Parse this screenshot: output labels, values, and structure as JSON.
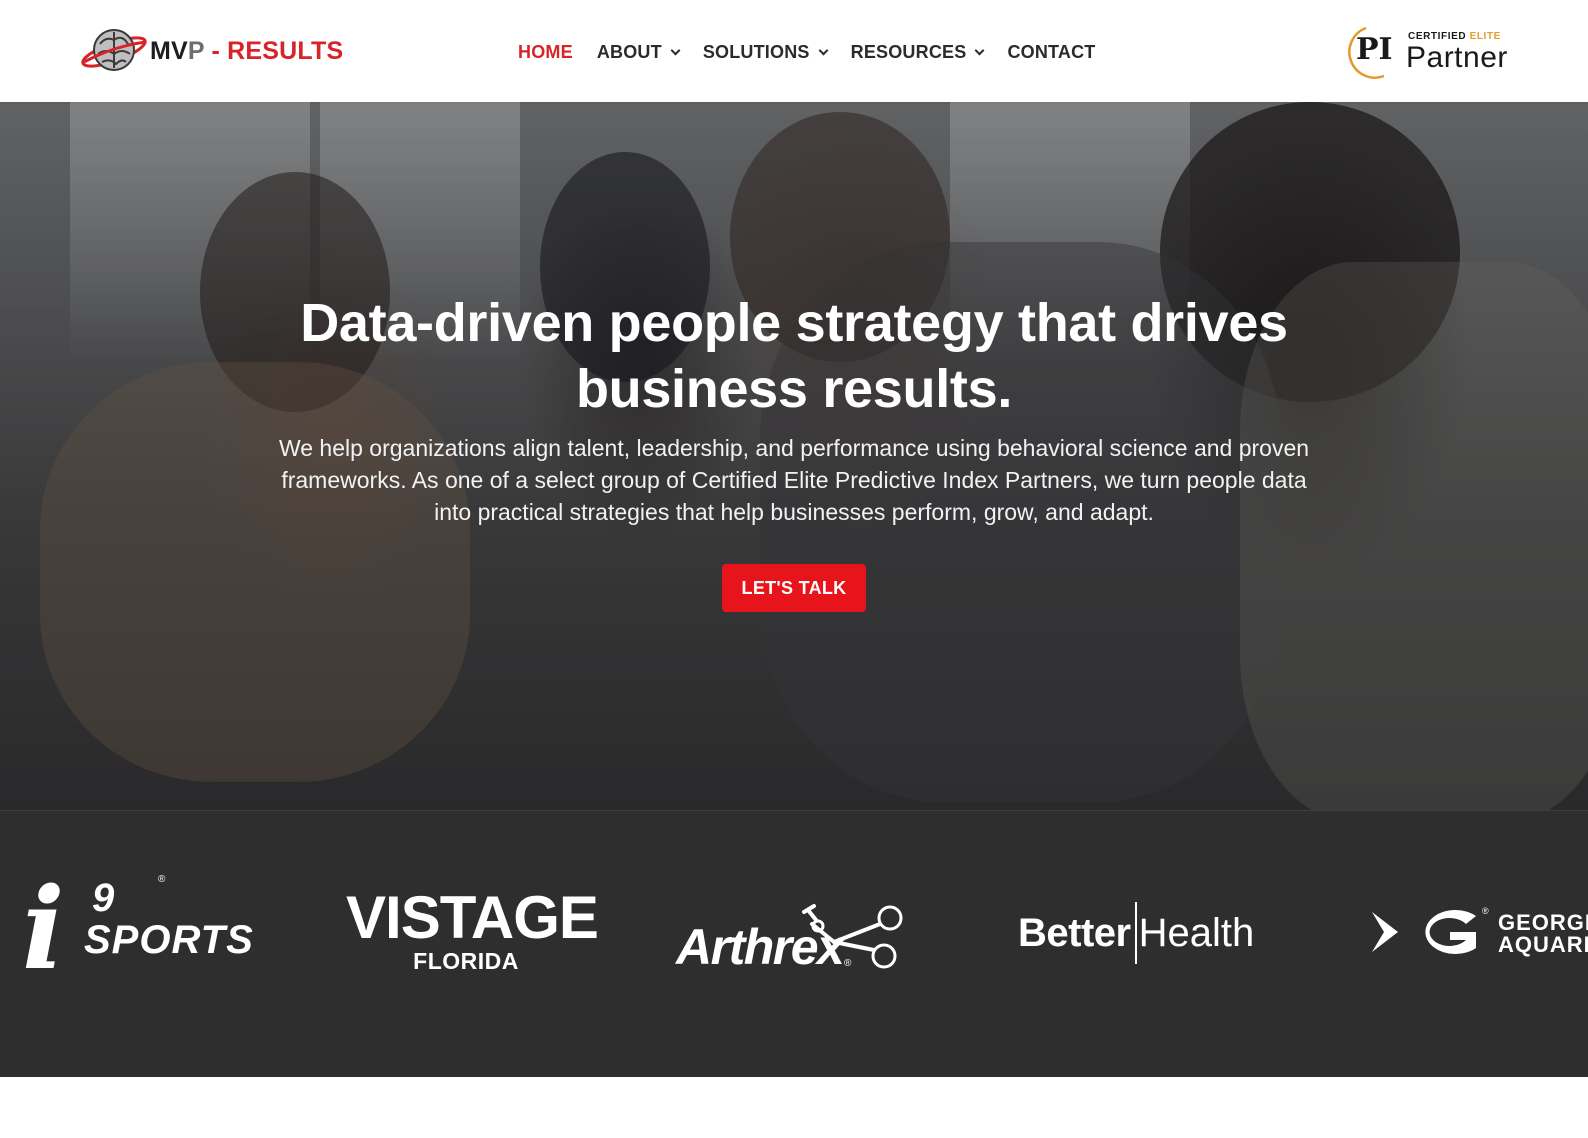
{
  "header": {
    "logo": {
      "part1": "MV",
      "part2": "P",
      "part3": " - RESULTS"
    },
    "nav": [
      {
        "label": "HOME",
        "active": true,
        "has_dropdown": false
      },
      {
        "label": "ABOUT",
        "active": false,
        "has_dropdown": true
      },
      {
        "label": "SOLUTIONS",
        "active": false,
        "has_dropdown": true
      },
      {
        "label": "RESOURCES",
        "active": false,
        "has_dropdown": true
      },
      {
        "label": "CONTACT",
        "active": false,
        "has_dropdown": false
      }
    ],
    "partner_badge": {
      "pi": "PI",
      "certified": "CERTIFIED",
      "elite": "ELITE",
      "partner": "Partner"
    }
  },
  "hero": {
    "title_line1": "Data-driven people strategy that drives",
    "title_line2": "business results.",
    "subtitle": "We help organizations align talent, leadership, and performance using behavioral science and proven frameworks. As one of a select group of Certified Elite Predictive Index Partners, we turn people data into practical strategies that help businesses perform, grow, and adapt.",
    "cta_label": "LET'S TALK"
  },
  "clients": {
    "i9sports": {
      "letter": "i",
      "nine": "9",
      "sports": "SPORTS",
      "reg": "®"
    },
    "vistage": {
      "name": "VISTAGE",
      "region": "FLORIDA"
    },
    "arthrex": {
      "name": "Arthrex",
      "reg": "®"
    },
    "betterhealth": {
      "part1": "Better",
      "part2": "Health"
    },
    "georgia": {
      "line1": "GEORGIA",
      "line2": "AQUARIUM",
      "reg": "®"
    }
  },
  "colors": {
    "accent": "#e8141c",
    "nav_active": "#d8232a",
    "nav_text": "#2b2b2b",
    "strip_bg": "#2e2e2f",
    "elite_gold": "#e39b2d"
  },
  "icons": {
    "logo": "brain-globe-icon",
    "dropdown": "chevron-down-icon",
    "partner": "pi-arc-icon",
    "arthrex": "scissors-icon",
    "georgia": "fish-g-icon"
  }
}
